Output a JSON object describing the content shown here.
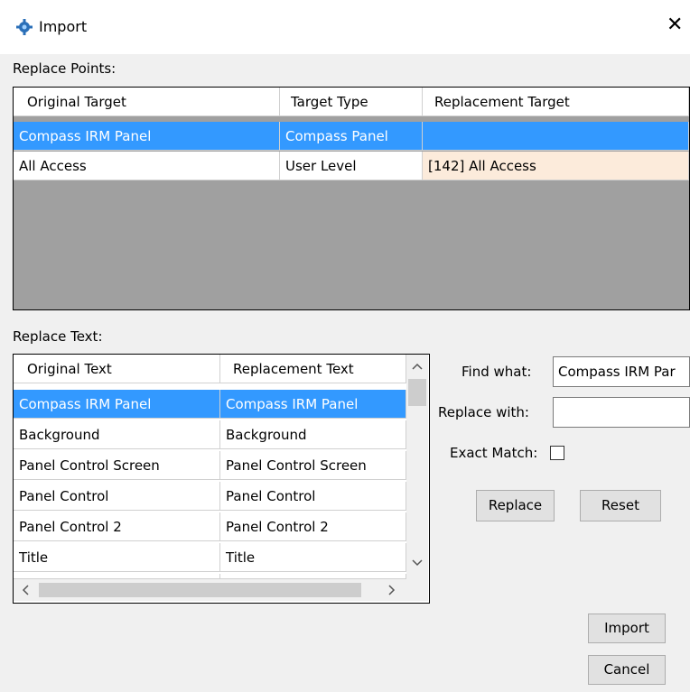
{
  "window": {
    "title": "Import",
    "close_glyph": "✕"
  },
  "replace_points": {
    "label": "Replace Points:",
    "columns": [
      "Original Target",
      "Target Type",
      "Replacement Target"
    ],
    "rows": [
      [
        "Compass IRM Panel",
        "Compass Panel",
        ""
      ],
      [
        "All Access",
        "User Level",
        "[142] All Access"
      ]
    ]
  },
  "replace_text": {
    "label": "Replace Text:",
    "columns": [
      "Original Text",
      "Replacement Text"
    ],
    "rows": [
      [
        "Compass IRM Panel",
        "Compass IRM Panel"
      ],
      [
        "Background",
        "Background"
      ],
      [
        "Panel Control Screen",
        "Panel Control Screen"
      ],
      [
        "Panel Control",
        "Panel Control"
      ],
      [
        "Panel Control 2",
        "Panel Control 2"
      ],
      [
        "Title",
        "Title"
      ]
    ]
  },
  "find": {
    "find_label": "Find what:",
    "find_value": "Compass IRM Par",
    "replace_label": "Replace with:",
    "replace_value": "",
    "exact_label": "Exact Match:",
    "exact_checked": false
  },
  "buttons": {
    "replace": "Replace",
    "reset": "Reset",
    "import": "Import",
    "cancel": "Cancel"
  },
  "icons": {
    "app": "gear-icon",
    "close": "close-icon",
    "scroll_up": "chevron-up-icon",
    "scroll_down": "chevron-down-icon",
    "scroll_left": "chevron-left-icon",
    "scroll_right": "chevron-right-icon"
  },
  "colors": {
    "selection": "#3399ff",
    "highlight": "#fcebdb",
    "grid_empty": "#a0a0a0"
  }
}
